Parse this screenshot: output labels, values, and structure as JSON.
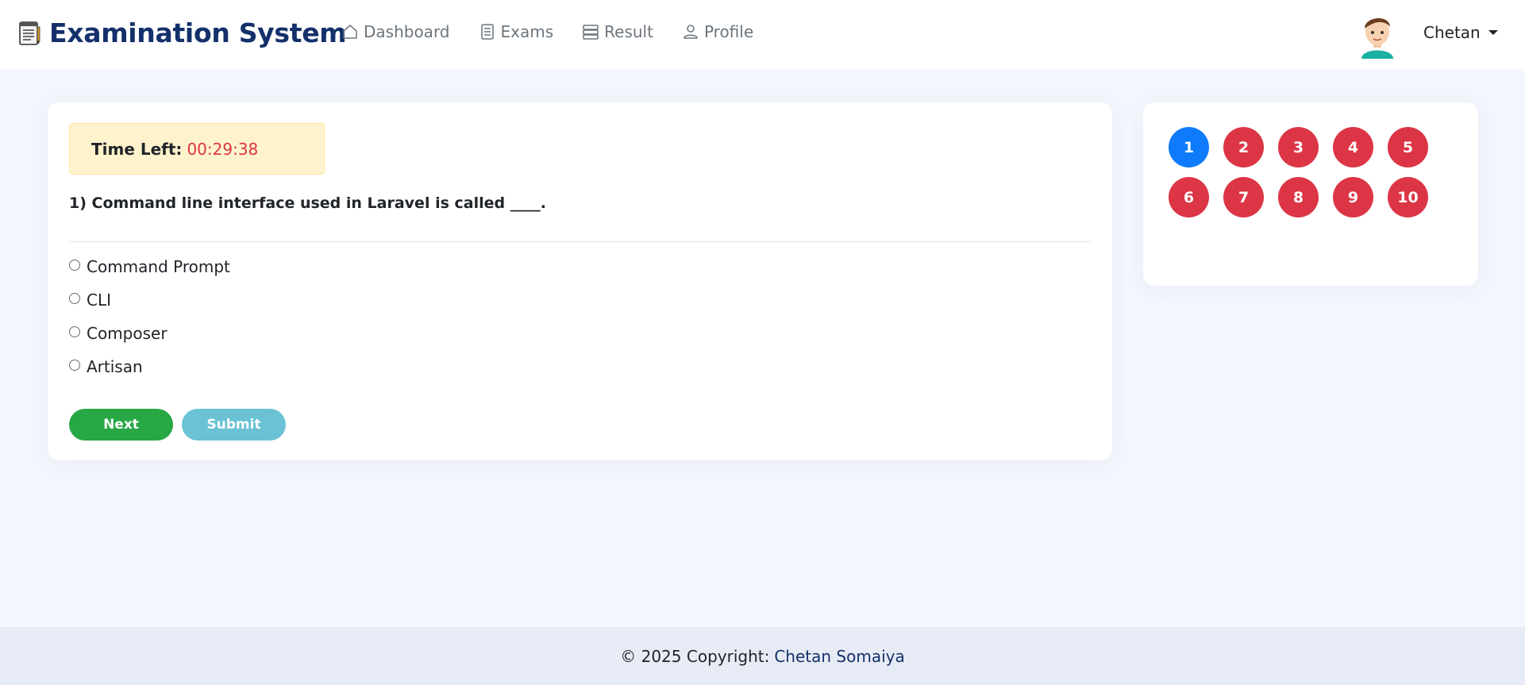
{
  "brand": {
    "title": "Examination System"
  },
  "nav": {
    "items": [
      {
        "label": "Dashboard",
        "icon": "home-icon"
      },
      {
        "label": "Exams",
        "icon": "document-list-icon"
      },
      {
        "label": "Result",
        "icon": "server-list-icon"
      },
      {
        "label": "Profile",
        "icon": "person-icon"
      }
    ],
    "user_name": "Chetan"
  },
  "quiz": {
    "timer_label": "Time Left:",
    "timer_value": "00:29:38",
    "question": "1) Command line interface used in Laravel is called ____.",
    "options": [
      "Command Prompt",
      "CLI",
      "Composer",
      "Artisan"
    ],
    "next_label": "Next",
    "submit_label": "Submit"
  },
  "question_nav": {
    "numbers": [
      "1",
      "2",
      "3",
      "4",
      "5",
      "6",
      "7",
      "8",
      "9",
      "10"
    ],
    "current": "1"
  },
  "footer": {
    "copyright": "© 2025 Copyright:",
    "author": "Chetan Somaiya"
  },
  "colors": {
    "brand": "#14306b",
    "current_question": "#0d7bfa",
    "unanswered_question": "#dc3545",
    "next_button": "#28a745",
    "submit_button": "#6ac2d4",
    "timer_value": "#dc3545"
  }
}
